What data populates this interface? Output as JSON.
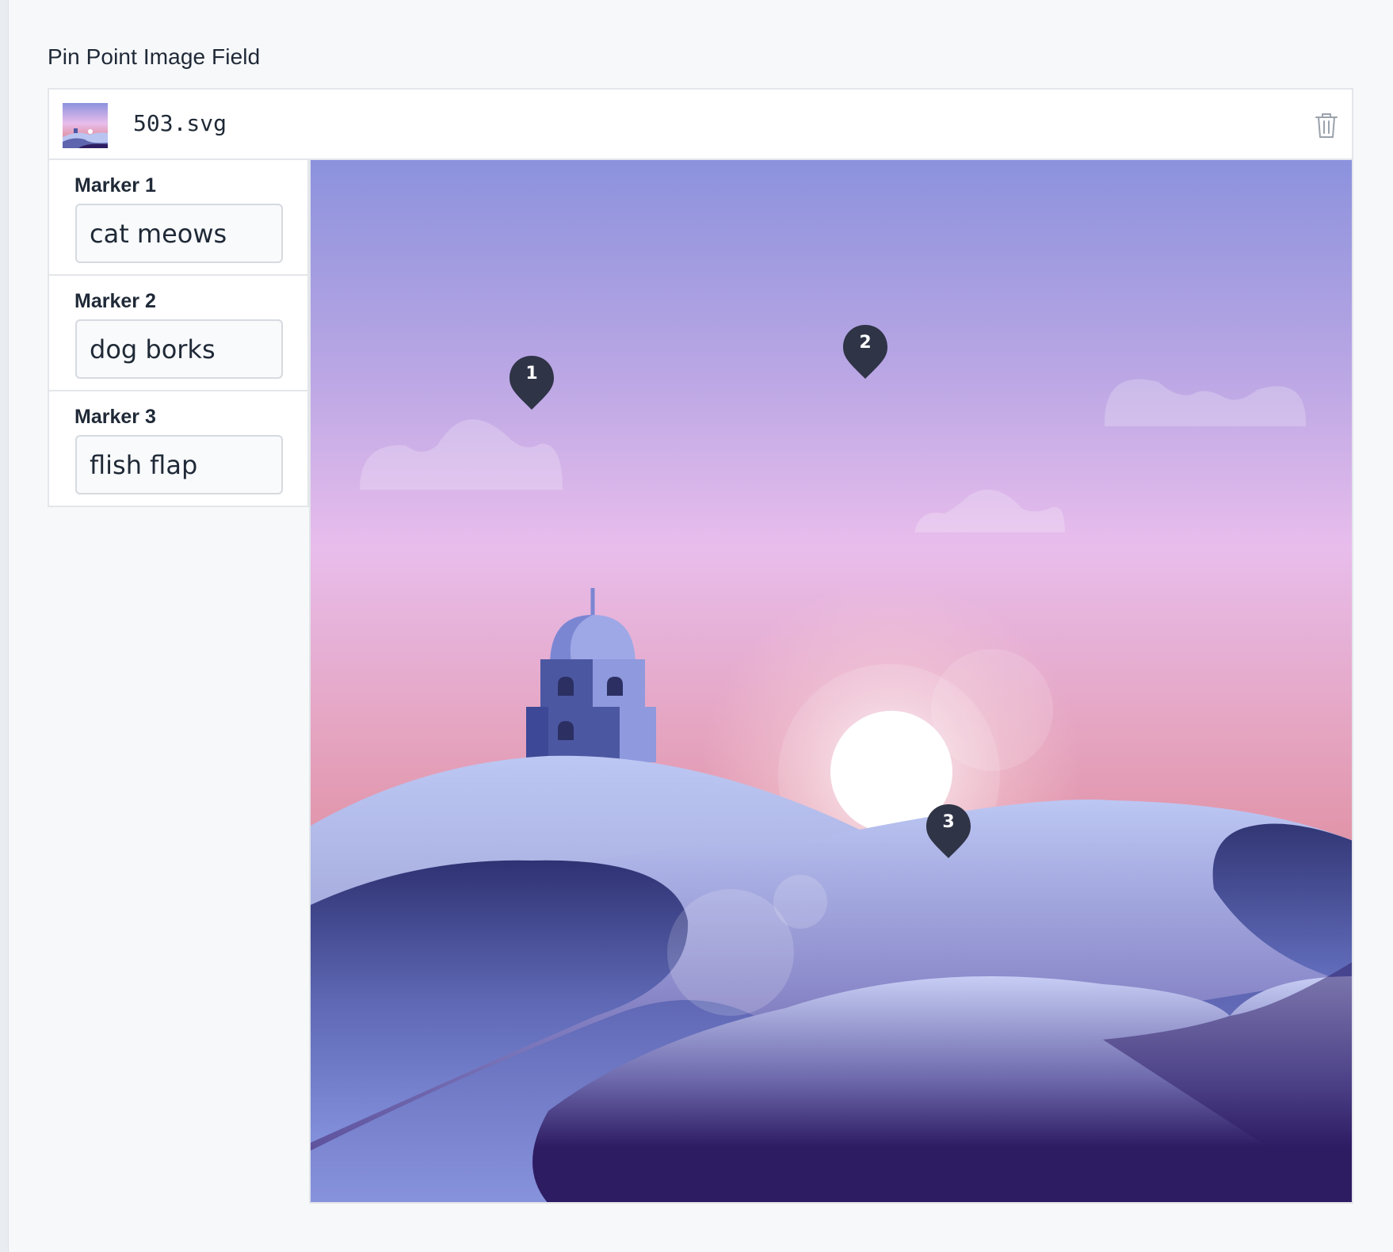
{
  "field": {
    "label": "Pin Point Image Field"
  },
  "file": {
    "name": "503.svg",
    "thumbnail_icon": "image-thumbnail",
    "delete_icon": "trash-icon"
  },
  "markers": [
    {
      "label": "Marker 1",
      "value": "cat meows",
      "pin": "1"
    },
    {
      "label": "Marker 2",
      "value": "dog borks",
      "pin": "2"
    },
    {
      "label": "Marker 3",
      "value": "flish flap",
      "pin": "3"
    }
  ],
  "colors": {
    "pin": "#2f3447",
    "sky_top": "#8c92dd",
    "sky_mid": "#e8bdec",
    "sky_low": "#e18c98",
    "dune_light": "#b9c4f1",
    "dune_dark": "#2e1c63"
  }
}
